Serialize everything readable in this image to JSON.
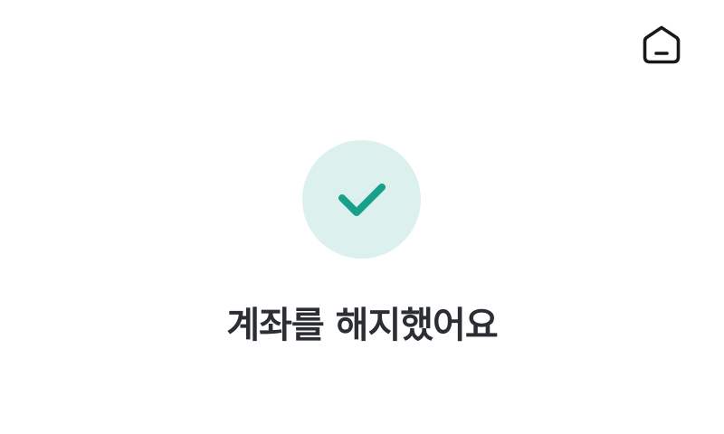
{
  "header": {
    "home_icon": "home-icon"
  },
  "status": {
    "icon": "check-icon",
    "circle_color": "#dcf0ee",
    "check_color": "#17a08a"
  },
  "message": {
    "title": "계좌를 해지했어요"
  }
}
